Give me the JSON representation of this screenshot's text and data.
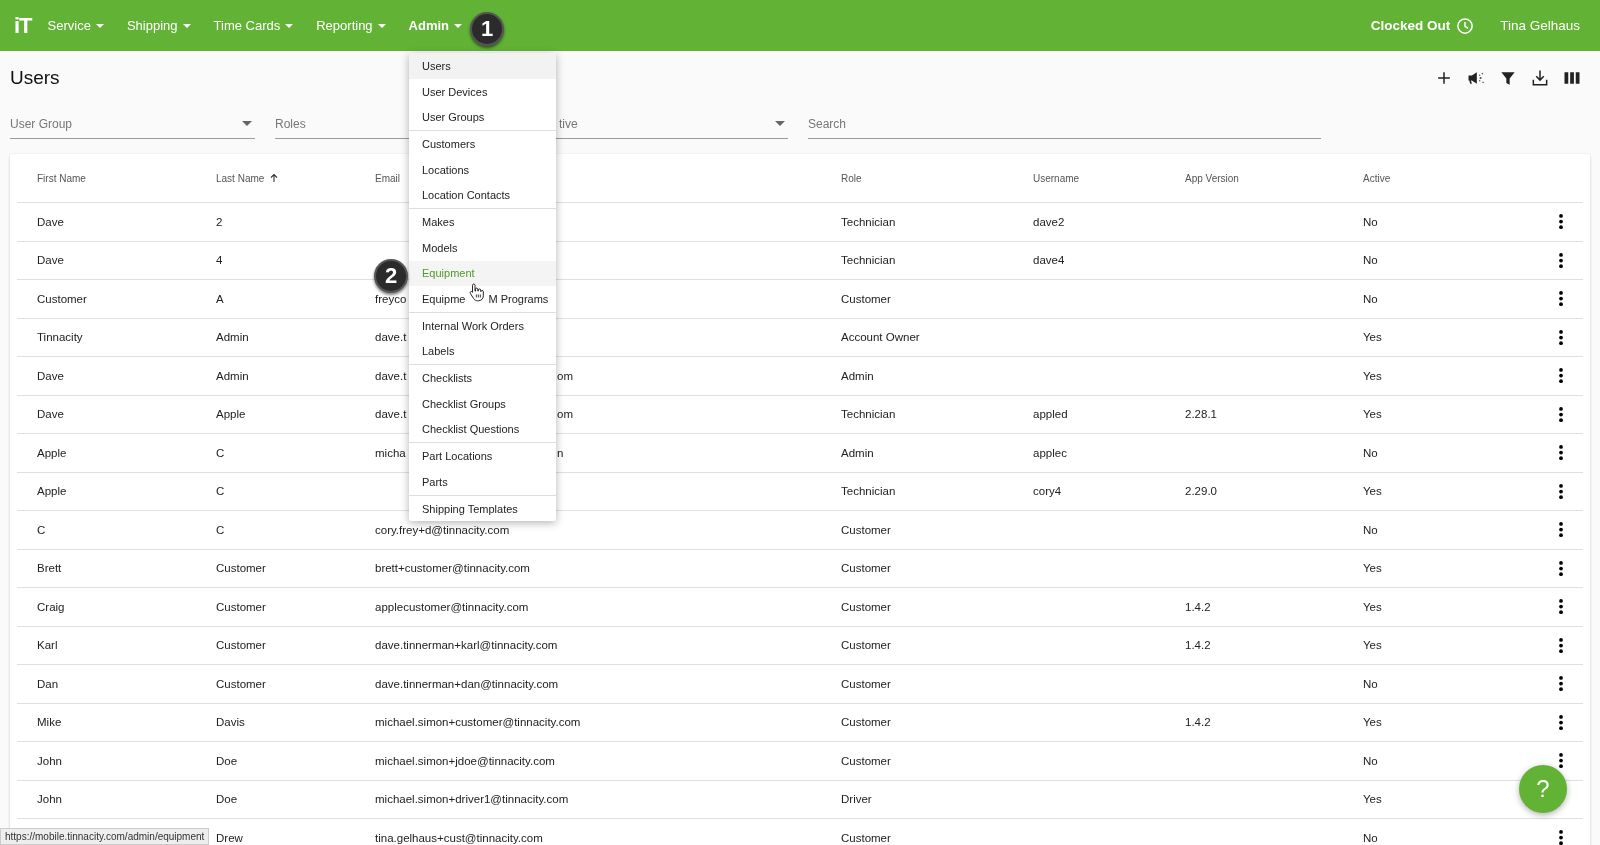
{
  "topbar": {
    "logo": "iT",
    "nav": [
      {
        "label": "Service",
        "selected": false
      },
      {
        "label": "Shipping",
        "selected": false
      },
      {
        "label": "Time Cards",
        "selected": false
      },
      {
        "label": "Reporting",
        "selected": false
      },
      {
        "label": "Admin",
        "selected": true
      }
    ],
    "clock_status": "Clocked Out",
    "user": "Tina Gelhaus"
  },
  "page": {
    "title": "Users"
  },
  "filters": [
    {
      "label": "User Group",
      "kind": "select"
    },
    {
      "label": "Roles",
      "kind": "text"
    },
    {
      "label": "tive",
      "kind": "select"
    },
    {
      "label": "Search",
      "kind": "text"
    }
  ],
  "table": {
    "columns": [
      {
        "label": "First Name",
        "sorted": false
      },
      {
        "label": "Last Name",
        "sorted": true
      },
      {
        "label": "Email",
        "sorted": false
      },
      {
        "label": "Role",
        "sorted": false
      },
      {
        "label": "Username",
        "sorted": false
      },
      {
        "label": "App Version",
        "sorted": false
      },
      {
        "label": "Active",
        "sorted": false
      }
    ],
    "rows": [
      {
        "first": "Dave",
        "last": "2",
        "role": "Technician",
        "username": "dave2",
        "active": "No",
        "actions": true
      },
      {
        "first": "Dave",
        "last": "4",
        "role": "Technician",
        "username": "dave4",
        "active": "No",
        "actions": true
      },
      {
        "first": "Customer",
        "last": "A",
        "email": "freyco",
        "role": "Customer",
        "active": "No",
        "actions": true
      },
      {
        "first": "Tinnacity",
        "last": "Admin",
        "email": "dave.t",
        "role": "Account Owner",
        "active": "Yes",
        "actions": true
      },
      {
        "first": "Dave",
        "last": "Admin",
        "email": "dave.t",
        "email_tail": "om",
        "role": "Admin",
        "active": "Yes",
        "actions": true
      },
      {
        "first": "Dave",
        "last": "Apple",
        "email": "dave.t",
        "email_tail": "om",
        "role": "Technician",
        "username": "appled",
        "app_version": "2.28.1",
        "active": "Yes",
        "actions": true
      },
      {
        "first": "Apple",
        "last": "C",
        "email": "micha",
        "email_tail": "n",
        "role": "Admin",
        "username": "applec",
        "active": "No",
        "actions": true
      },
      {
        "first": "Apple",
        "last": "C",
        "role": "Technician",
        "username": "cory4",
        "app_version": "2.29.0",
        "active": "Yes",
        "actions": true
      },
      {
        "first": "C",
        "last": "C",
        "email": "cory.frey+d@tinnacity.com",
        "role": "Customer",
        "active": "No",
        "actions": true
      },
      {
        "first": "Brett",
        "last": "Customer",
        "email": "brett+customer@tinnacity.com",
        "role": "Customer",
        "active": "Yes",
        "actions": true
      },
      {
        "first": "Craig",
        "last": "Customer",
        "email": "applecustomer@tinnacity.com",
        "role": "Customer",
        "app_version": "1.4.2",
        "active": "Yes",
        "actions": true
      },
      {
        "first": "Karl",
        "last": "Customer",
        "email": "dave.tinnerman+karl@tinnacity.com",
        "role": "Customer",
        "app_version": "1.4.2",
        "active": "Yes",
        "actions": true
      },
      {
        "first": "Dan",
        "last": "Customer",
        "email": "dave.tinnerman+dan@tinnacity.com",
        "role": "Customer",
        "active": "No",
        "actions": true
      },
      {
        "first": "Mike",
        "last": "Davis",
        "email": "michael.simon+customer@tinnacity.com",
        "role": "Customer",
        "app_version": "1.4.2",
        "active": "Yes",
        "actions": true
      },
      {
        "first": "John",
        "last": "Doe",
        "email": "michael.simon+jdoe@tinnacity.com",
        "role": "Customer",
        "active": "No",
        "actions": true
      },
      {
        "first": "John",
        "last": "Doe",
        "email": "michael.simon+driver1@tinnacity.com",
        "role": "Driver",
        "active": "Yes",
        "actions": false
      },
      {
        "last": "Drew",
        "email": "tina.gelhaus+cust@tinnacity.com",
        "role": "Customer",
        "active": "No",
        "actions": true
      }
    ]
  },
  "admin_menu": {
    "groups": [
      [
        {
          "label": "Users",
          "selected": true,
          "hovered": false
        },
        {
          "label": "User Devices",
          "selected": false,
          "hovered": false
        },
        {
          "label": "User Groups",
          "selected": false,
          "hovered": false
        }
      ],
      [
        {
          "label": "Customers",
          "selected": false,
          "hovered": false
        },
        {
          "label": "Locations",
          "selected": false,
          "hovered": false
        },
        {
          "label": "Location Contacts",
          "selected": false,
          "hovered": false
        }
      ],
      [
        {
          "label": "Makes",
          "selected": false,
          "hovered": false
        },
        {
          "label": "Models",
          "selected": false,
          "hovered": false
        },
        {
          "label": "Equipment",
          "selected": false,
          "hovered": true
        },
        {
          "label": "Equipme",
          "label_tail": "M Programs",
          "selected": false,
          "hovered": false
        }
      ],
      [
        {
          "label": "Internal Work Orders",
          "selected": false,
          "hovered": false
        },
        {
          "label": "Labels",
          "selected": false,
          "hovered": false
        }
      ],
      [
        {
          "label": "Checklists",
          "selected": false,
          "hovered": false
        },
        {
          "label": "Checklist Groups",
          "selected": false,
          "hovered": false
        },
        {
          "label": "Checklist Questions",
          "selected": false,
          "hovered": false
        }
      ],
      [
        {
          "label": "Part Locations",
          "selected": false,
          "hovered": false
        },
        {
          "label": "Parts",
          "selected": false,
          "hovered": false
        }
      ],
      [
        {
          "label": "Shipping Templates",
          "selected": false,
          "hovered": false
        }
      ]
    ]
  },
  "step_badges": [
    "1",
    "2"
  ],
  "status_url": "https://mobile.tinnacity.com/admin/equipment",
  "help_button": "?"
}
